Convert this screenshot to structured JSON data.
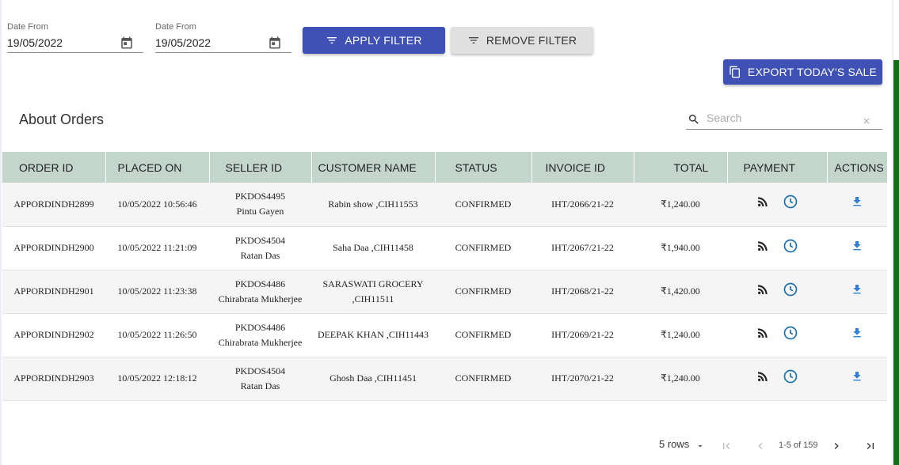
{
  "filters": {
    "date_from_1": {
      "label": "Date From",
      "value": "19/05/2022",
      "icon": "calendar-icon"
    },
    "date_from_2": {
      "label": "Date From",
      "value": "19/05/2022",
      "icon": "calendar-icon"
    },
    "apply_label": "APPLY FILTER",
    "remove_label": "REMOVE FILTER",
    "filter_icon": "filter-icon"
  },
  "export": {
    "label": "EXPORT TODAY'S SALE",
    "icon": "copy-icon"
  },
  "card": {
    "title": "About Orders",
    "search_placeholder": "Search"
  },
  "table": {
    "headers": [
      "ORDER ID",
      "PLACED ON",
      "SELLER ID",
      "CUSTOMER NAME",
      "STATUS",
      "INVOICE ID",
      "TOTAL",
      "PAYMENT",
      "ACTIONS"
    ],
    "rows": [
      {
        "order_id": "APPORDINDH2899",
        "placed_on": "10/05/2022 10:56:46",
        "seller_code": "PKDOS4495",
        "seller_name": "Pintu Gayen",
        "customer_l1": "Rabin show ,CIH11553",
        "customer_l2": "",
        "status": "CONFIRMED",
        "invoice": "IHT/2066/21-22",
        "total": "₹1,240.00"
      },
      {
        "order_id": "APPORDINDH2900",
        "placed_on": "10/05/2022 11:21:09",
        "seller_code": "PKDOS4504",
        "seller_name": "Ratan Das",
        "customer_l1": "Saha Daa ,CIH11458",
        "customer_l2": "",
        "status": "CONFIRMED",
        "invoice": "IHT/2067/21-22",
        "total": "₹1,940.00"
      },
      {
        "order_id": "APPORDINDH2901",
        "placed_on": "10/05/2022 11:23:38",
        "seller_code": "PKDOS4486",
        "seller_name": "Chirabrata Mukherjee",
        "customer_l1": "SARASWATI GROCERY",
        "customer_l2": ",CIH11511",
        "status": "CONFIRMED",
        "invoice": "IHT/2068/21-22",
        "total": "₹1,420.00"
      },
      {
        "order_id": "APPORDINDH2902",
        "placed_on": "10/05/2022 11:26:50",
        "seller_code": "PKDOS4486",
        "seller_name": "Chirabrata Mukherjee",
        "customer_l1": "DEEPAK KHAN ,CIH11443",
        "customer_l2": "",
        "status": "CONFIRMED",
        "invoice": "IHT/2069/21-22",
        "total": "₹1,240.00"
      },
      {
        "order_id": "APPORDINDH2903",
        "placed_on": "10/05/2022 12:18:12",
        "seller_code": "PKDOS4504",
        "seller_name": "Ratan Das",
        "customer_l1": "Ghosh Daa ,CIH11451",
        "customer_l2": "",
        "status": "CONFIRMED",
        "invoice": "IHT/2070/21-22",
        "total": "₹1,240.00"
      }
    ],
    "payment_icons": [
      "rss-feed-icon",
      "clock-icon"
    ],
    "action_icon": "download-icon"
  },
  "pagination": {
    "rows_label": "5 rows",
    "range": "1-5 of 159"
  },
  "colors": {
    "primary": "#3f51b5",
    "header_bg": "#c3d5cd",
    "accent_icon": "#1a6fa8",
    "download": "#2f7fd6",
    "side_bar": "#166b16"
  }
}
